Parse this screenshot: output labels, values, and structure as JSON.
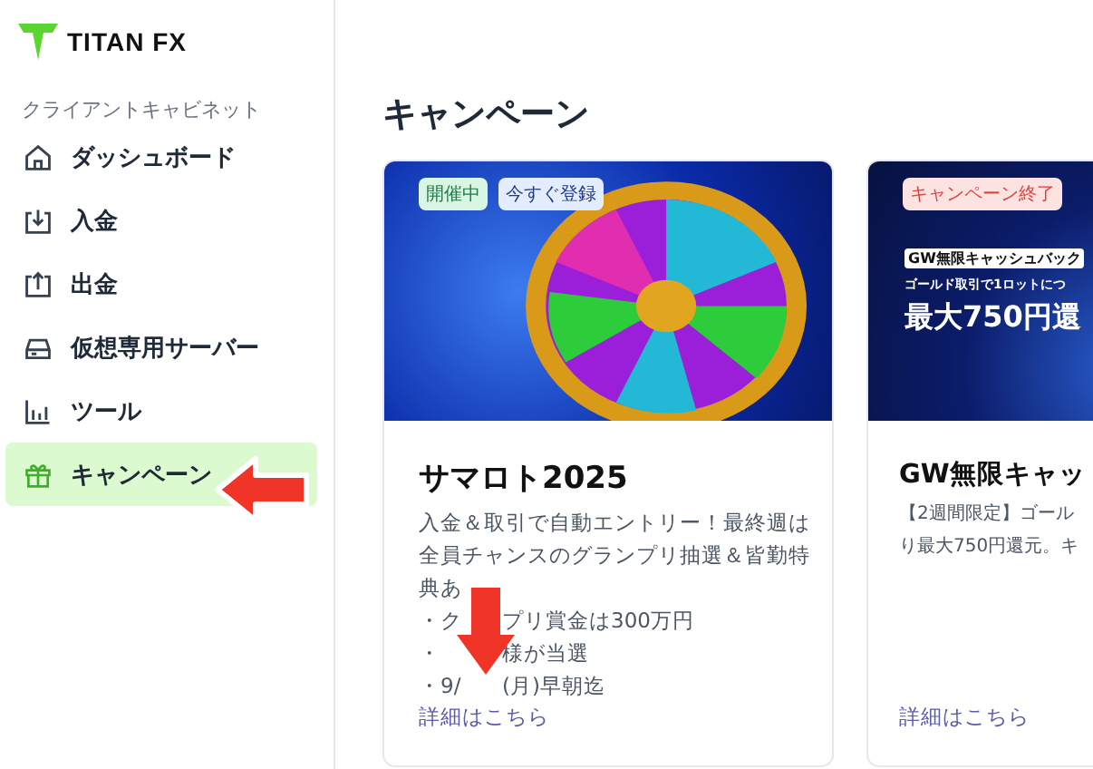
{
  "logo": {
    "text": "TITAN FX"
  },
  "sidebar": {
    "section_label": "クライアントキャビネット",
    "items": [
      {
        "label": "ダッシュボード",
        "selected": false
      },
      {
        "label": "入金",
        "selected": false
      },
      {
        "label": "出金",
        "selected": false
      },
      {
        "label": "仮想専用サーバー",
        "selected": false
      },
      {
        "label": "ツール",
        "selected": false
      },
      {
        "label": "キャンペーン",
        "selected": true
      }
    ]
  },
  "page_title": "キャンペーン",
  "cards": [
    {
      "badges": [
        {
          "label": "開催中",
          "kind": "active"
        },
        {
          "label": "今すぐ登録",
          "kind": "register"
        }
      ],
      "title": "サマロト2025",
      "description_lines": [
        "入金＆取引で自動エントリー！最終週は",
        "全員チャンスのグランプリ抽選＆皆勤特",
        "典あ"
      ],
      "bullets": [
        {
          "before": "・ク",
          "after": "プリ賞金は300万円"
        },
        {
          "before": "・",
          "after": "様が当選"
        },
        {
          "before": "・9/",
          "after": "(月)早朝迄"
        }
      ],
      "link": "詳細はこちら"
    },
    {
      "badges": [
        {
          "label": "キャンペーン終了",
          "kind": "ended"
        }
      ],
      "banner_texts": [
        "GW無限キャッシュバック",
        "ゴールド取引で1ロットにつ",
        "最大750円還"
      ],
      "title": "GW無限キャッ",
      "description_lines": [
        "【2週間限定】ゴール",
        "り最大750円還元。キ"
      ],
      "link": "詳細はこちら"
    }
  ]
}
